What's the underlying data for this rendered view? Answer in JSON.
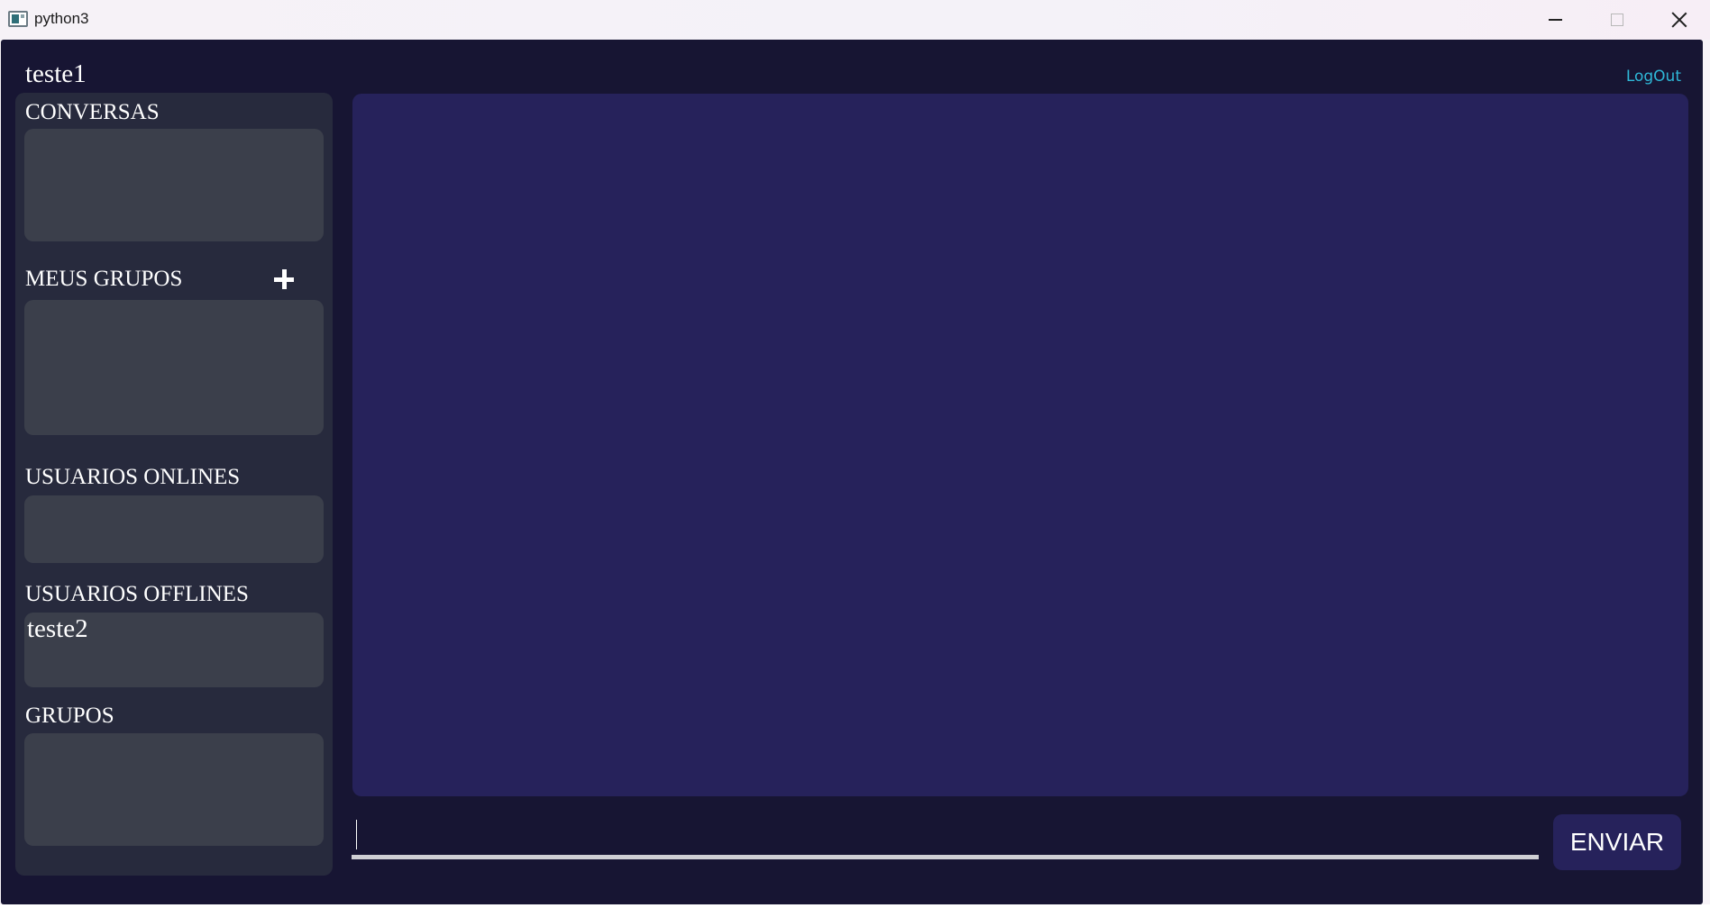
{
  "window": {
    "title": "python3",
    "icon": "app-window-icon",
    "controls": [
      "minimize-icon",
      "maximize-icon",
      "close-icon"
    ]
  },
  "header": {
    "username": "teste1",
    "logout_label": "LogOut"
  },
  "sidebar": {
    "conversas_label": "CONVERSAS",
    "meus_grupos_label": "MEUS GRUPOS",
    "add_group_icon": "plus-icon",
    "usuarios_onlines_label": "USUARIOS ONLINES",
    "usuarios_offlines_label": "USUARIOS OFFLINES",
    "offline_users": [
      "teste2"
    ],
    "grupos_label": "GRUPOS"
  },
  "composer": {
    "message_value": "",
    "send_label": "ENVIAR"
  },
  "colors": {
    "app_background": "#171533",
    "sidebar_background": "#272a3d",
    "list_background": "#3b3f4b",
    "chat_background": "#26225b",
    "logout_link": "#2fb8d8",
    "text": "#ffffff"
  }
}
